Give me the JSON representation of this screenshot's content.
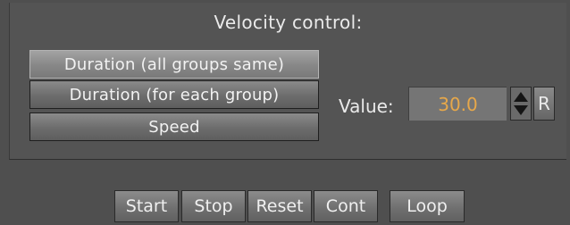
{
  "velocity": {
    "title": "Velocity control:",
    "options": [
      {
        "label": "Duration (all groups same)",
        "selected": true
      },
      {
        "label": "Duration (for each group)",
        "selected": false
      },
      {
        "label": "Speed",
        "selected": false
      }
    ]
  },
  "value": {
    "label": "Value:",
    "current": "30.0",
    "reset_label": "R",
    "value_color": "#e7a84a"
  },
  "controls": {
    "start": "Start",
    "stop": "Stop",
    "reset": "Reset",
    "cont": "Cont",
    "loop": "Loop"
  },
  "icons": {
    "spinner": "up-down-arrow-icon"
  }
}
